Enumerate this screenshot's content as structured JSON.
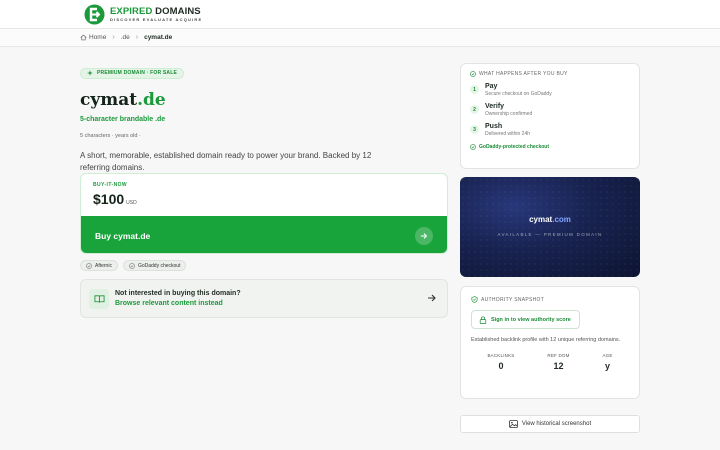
{
  "brand": {
    "name_part1": "EXPIRED",
    "name_part2": "DOMAINS",
    "tagline": "DISCOVER EVALUATE ACQUIRE"
  },
  "breadcrumb": {
    "home": "Home",
    "tld": ".de",
    "current": "cymat.de"
  },
  "domain": {
    "badge": "PREMIUM DOMAIN · FOR SALE",
    "name": "cymat",
    "tld": ".de",
    "subtitle": "5-character brandable .de",
    "meta": "5 characters · years old ·",
    "description": "A short, memorable, established domain ready to power your brand. Backed by 12 referring domains."
  },
  "purchase": {
    "label": "BUY-IT-NOW",
    "price": "$100",
    "currency": "USD",
    "button_label": "Buy cymat.de"
  },
  "chips": [
    {
      "label": "Afternic"
    },
    {
      "label": "GoDaddy checkout"
    }
  ],
  "alternative": {
    "question": "Not interested in buying this domain?",
    "link": "Browse relevant content instead"
  },
  "how_it_works": {
    "heading": "WHAT HAPPENS AFTER YOU BUY",
    "steps": [
      {
        "num": "1",
        "title": "Pay",
        "sub": "Secure checkout on GoDaddy"
      },
      {
        "num": "2",
        "title": "Verify",
        "sub": "Ownership confirmed"
      },
      {
        "num": "3",
        "title": "Push",
        "sub": "Delivered within 24h"
      }
    ],
    "footer": "GoDaddy-protected checkout"
  },
  "preview": {
    "name": "cymat",
    "tld": ".com",
    "subtitle": "AVAILABLE — PREMIUM DOMAIN"
  },
  "authority": {
    "heading": "AUTHORITY SNAPSHOT",
    "signin_label": "Sign in to view authority score",
    "description": "Established backlink profile with 12 unique referring domains.",
    "stats": [
      {
        "label": "BACKLINKS",
        "value": "0"
      },
      {
        "label": "REF DOM",
        "value": "12"
      },
      {
        "label": "AGE",
        "value": "y"
      }
    ]
  },
  "history_button": "View historical screenshot",
  "colors": {
    "accent": "#18a33b",
    "accent_dark": "#1a8b36",
    "preview_bg": "#18224f"
  }
}
